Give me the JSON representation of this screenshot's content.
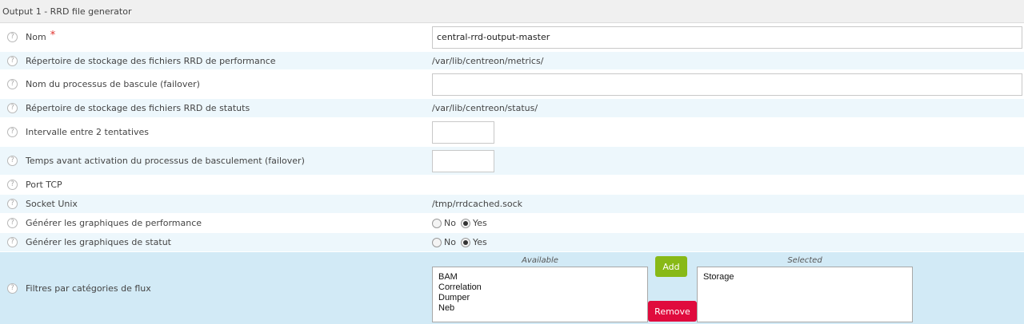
{
  "header": {
    "title": "Output 1 - RRD file generator"
  },
  "help_glyph": "?",
  "fields": {
    "nom": {
      "label": "Nom",
      "required_mark": "*",
      "value": "central-rrd-output-master"
    },
    "metrics_dir": {
      "label": "Répertoire de stockage des fichiers RRD de performance",
      "value": "/var/lib/centreon/metrics/"
    },
    "failover": {
      "label": "Nom du processus de bascule (failover)",
      "value": ""
    },
    "status_dir": {
      "label": "Répertoire de stockage des fichiers RRD de statuts",
      "value": "/var/lib/centreon/status/"
    },
    "retry_interval": {
      "label": "Intervalle entre 2 tentatives",
      "value": ""
    },
    "buffering_timeout": {
      "label": "Temps avant activation du processus de basculement (failover)",
      "value": ""
    },
    "port": {
      "label": "Port TCP"
    },
    "socket": {
      "label": "Socket Unix",
      "value": "/tmp/rrdcached.sock"
    },
    "perf_graphs": {
      "label": "Générer les graphiques de performance",
      "options": [
        "No",
        "Yes"
      ],
      "selected": "Yes"
    },
    "status_graphs": {
      "label": "Générer les graphiques de statut",
      "options": [
        "No",
        "Yes"
      ],
      "selected": "Yes"
    },
    "filters": {
      "label": "Filtres par catégories de flux",
      "available_title": "Available",
      "selected_title": "Selected",
      "available": [
        "BAM",
        "Correlation",
        "Dumper",
        "Neb"
      ],
      "selected": [
        "Storage"
      ],
      "add_label": "Add",
      "remove_label": "Remove"
    }
  },
  "colors": {
    "add_button": "#88b917",
    "remove_button": "#e00b3d",
    "row_alt": "#edf7fc",
    "row_filters": "#d2eaf6"
  }
}
